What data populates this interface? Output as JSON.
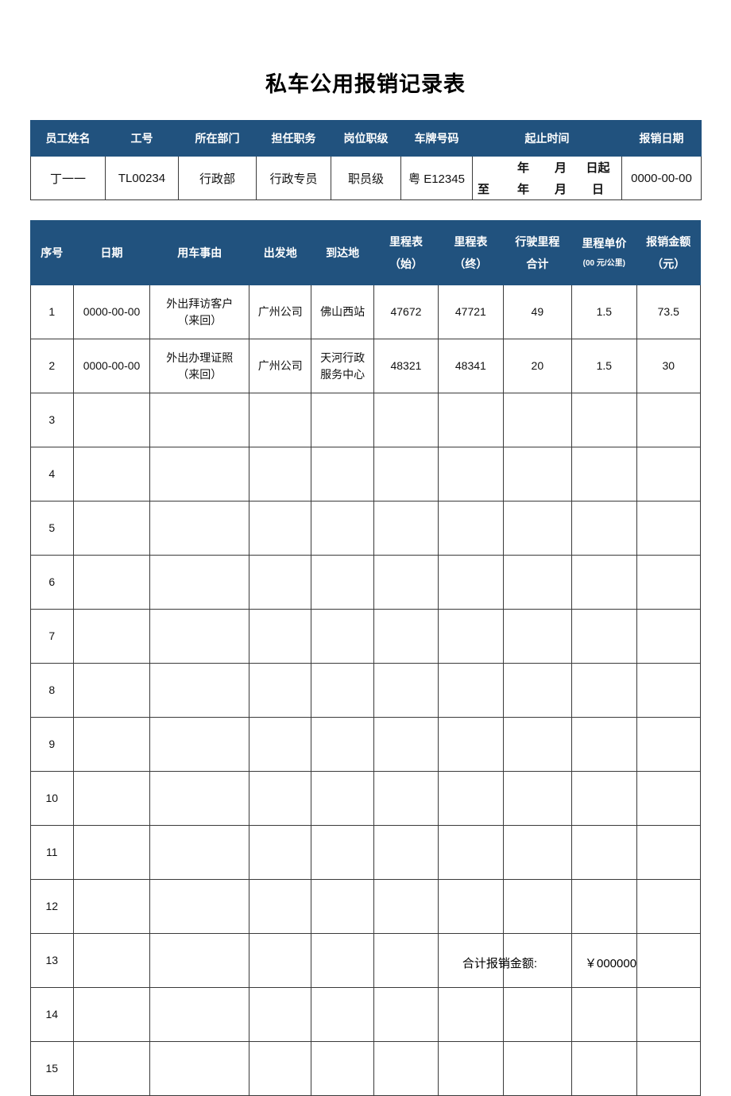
{
  "document": {
    "title": "私车公用报销记录表",
    "currency_symbol": "￥"
  },
  "info_table": {
    "headers": [
      "员工姓名",
      "工号",
      "所在部门",
      "担任职务",
      "岗位职级",
      "车牌号码",
      "起止时间",
      "报销日期"
    ],
    "values": {
      "employee_name": "丁一一",
      "employee_id": "TL00234",
      "department": "行政部",
      "position": "行政专员",
      "job_grade": "职员级",
      "plate_number": "粤 E12345",
      "period": {
        "line1": {
          "lead": "",
          "year": "年",
          "month": "月",
          "day": "日起"
        },
        "line2": {
          "lead": "至",
          "year": "年",
          "month": "月",
          "day": "日"
        }
      },
      "reimbursement_date": "0000-00-00"
    }
  },
  "ledger_table": {
    "headers": [
      {
        "line1": "序号",
        "line2": ""
      },
      {
        "line1": "日期",
        "line2": ""
      },
      {
        "line1": "用车事由",
        "line2": ""
      },
      {
        "line1": "出发地",
        "line2": ""
      },
      {
        "line1": "到达地",
        "line2": ""
      },
      {
        "line1": "里程表",
        "line2": "（始）"
      },
      {
        "line1": "里程表",
        "line2": "（终）"
      },
      {
        "line1": "行驶里程",
        "line2": "合计"
      },
      {
        "line1": "里程单价",
        "line2": "(00 元/公里)",
        "line2_small": true
      },
      {
        "line1": "报销金额",
        "line2": "（元）"
      }
    ],
    "rows": [
      {
        "no": "1",
        "date": "0000-00-00",
        "reason_line1": "外出拜访客户",
        "reason_line2": "（来回）",
        "origin": "广州公司",
        "destination_line1": "佛山西站",
        "destination_line2": "",
        "odometer_start": "47672",
        "odometer_end": "47721",
        "distance": "49",
        "unit_price": "1.5",
        "amount": "73.5"
      },
      {
        "no": "2",
        "date": "0000-00-00",
        "reason_line1": "外出办理证照",
        "reason_line2": "（来回）",
        "origin": "广州公司",
        "destination_line1": "天河行政",
        "destination_line2": "服务中心",
        "odometer_start": "48321",
        "odometer_end": "48341",
        "distance": "20",
        "unit_price": "1.5",
        "amount": "30"
      },
      {
        "no": "3",
        "date": "",
        "reason_line1": "",
        "reason_line2": "",
        "origin": "",
        "destination_line1": "",
        "destination_line2": "",
        "odometer_start": "",
        "odometer_end": "",
        "distance": "",
        "unit_price": "",
        "amount": ""
      },
      {
        "no": "4",
        "date": "",
        "reason_line1": "",
        "reason_line2": "",
        "origin": "",
        "destination_line1": "",
        "destination_line2": "",
        "odometer_start": "",
        "odometer_end": "",
        "distance": "",
        "unit_price": "",
        "amount": ""
      },
      {
        "no": "5",
        "date": "",
        "reason_line1": "",
        "reason_line2": "",
        "origin": "",
        "destination_line1": "",
        "destination_line2": "",
        "odometer_start": "",
        "odometer_end": "",
        "distance": "",
        "unit_price": "",
        "amount": ""
      },
      {
        "no": "6",
        "date": "",
        "reason_line1": "",
        "reason_line2": "",
        "origin": "",
        "destination_line1": "",
        "destination_line2": "",
        "odometer_start": "",
        "odometer_end": "",
        "distance": "",
        "unit_price": "",
        "amount": ""
      },
      {
        "no": "7",
        "date": "",
        "reason_line1": "",
        "reason_line2": "",
        "origin": "",
        "destination_line1": "",
        "destination_line2": "",
        "odometer_start": "",
        "odometer_end": "",
        "distance": "",
        "unit_price": "",
        "amount": ""
      },
      {
        "no": "8",
        "date": "",
        "reason_line1": "",
        "reason_line2": "",
        "origin": "",
        "destination_line1": "",
        "destination_line2": "",
        "odometer_start": "",
        "odometer_end": "",
        "distance": "",
        "unit_price": "",
        "amount": ""
      },
      {
        "no": "9",
        "date": "",
        "reason_line1": "",
        "reason_line2": "",
        "origin": "",
        "destination_line1": "",
        "destination_line2": "",
        "odometer_start": "",
        "odometer_end": "",
        "distance": "",
        "unit_price": "",
        "amount": ""
      },
      {
        "no": "10",
        "date": "",
        "reason_line1": "",
        "reason_line2": "",
        "origin": "",
        "destination_line1": "",
        "destination_line2": "",
        "odometer_start": "",
        "odometer_end": "",
        "distance": "",
        "unit_price": "",
        "amount": ""
      },
      {
        "no": "11",
        "date": "",
        "reason_line1": "",
        "reason_line2": "",
        "origin": "",
        "destination_line1": "",
        "destination_line2": "",
        "odometer_start": "",
        "odometer_end": "",
        "distance": "",
        "unit_price": "",
        "amount": ""
      },
      {
        "no": "12",
        "date": "",
        "reason_line1": "",
        "reason_line2": "",
        "origin": "",
        "destination_line1": "",
        "destination_line2": "",
        "odometer_start": "",
        "odometer_end": "",
        "distance": "",
        "unit_price": "",
        "amount": ""
      },
      {
        "no": "13",
        "date": "",
        "reason_line1": "",
        "reason_line2": "",
        "origin": "",
        "destination_line1": "",
        "destination_line2": "",
        "odometer_start": "",
        "odometer_end": "",
        "distance": "",
        "unit_price": "",
        "amount": ""
      },
      {
        "no": "14",
        "date": "",
        "reason_line1": "",
        "reason_line2": "",
        "origin": "",
        "destination_line1": "",
        "destination_line2": "",
        "odometer_start": "",
        "odometer_end": "",
        "distance": "",
        "unit_price": "",
        "amount": ""
      },
      {
        "no": "15",
        "date": "",
        "reason_line1": "",
        "reason_line2": "",
        "origin": "",
        "destination_line1": "",
        "destination_line2": "",
        "odometer_start": "",
        "odometer_end": "",
        "distance": "",
        "unit_price": "",
        "amount": ""
      }
    ]
  },
  "footer": {
    "total_label": "合计报销金额:",
    "total_value": "￥000000"
  },
  "colors": {
    "header_blue": "#21527E",
    "header_text": "#FFFFFF",
    "border": "#3A3A3A",
    "body_text": "#111111",
    "page_background": "#FFFFFF"
  }
}
